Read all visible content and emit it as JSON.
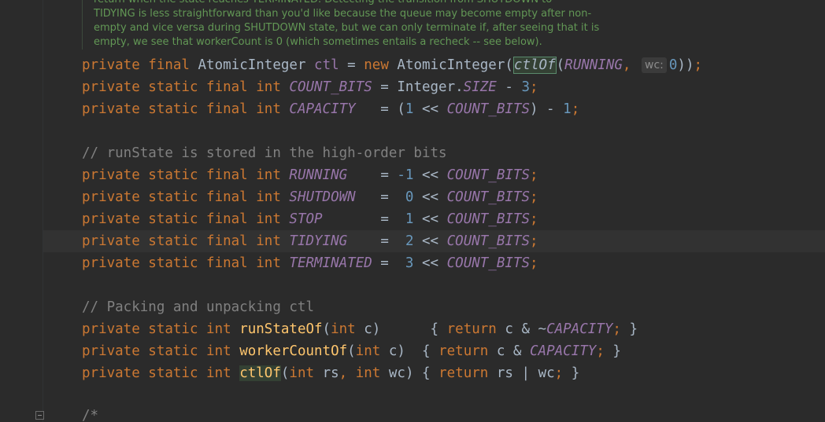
{
  "doc_comment": [
    "return when the state reaches TERMINATED. Detecting the transition from SHUTDOWN to",
    "TIDYING is less straightforward than you'd like because the queue may become empty after non-",
    "empty and vice versa during SHUTDOWN state, but we can only terminate if, after seeing that it is",
    "empty, we see that workerCount is 0 (which sometimes entails a recheck -- see below)."
  ],
  "lines": {
    "ctl": {
      "kw": "private final ",
      "type": "AtomicInteger ",
      "name": "ctl",
      "eq": " = ",
      "new": "new ",
      "ctor": "AtomicInteger(",
      "call": "ctlOf",
      "paren": "(",
      "arg1": "RUNNING",
      "comma": ", ",
      "hint": "wc:",
      "arg2": "0",
      "close": "))",
      "semi": ";"
    },
    "count_bits": {
      "kw": "private static final int ",
      "name": "COUNT_BITS",
      "eq": " = Integer.",
      "size": "SIZE",
      "minus": " - ",
      "num": "3",
      "semi": ";"
    },
    "capacity": {
      "kw": "private static final int ",
      "name": "CAPACITY",
      "eq": "   = (",
      "one": "1",
      "shift": " << ",
      "ref": "COUNT_BITS",
      "rest": ") - ",
      "num": "1",
      "semi": ";"
    },
    "comment_runstate": "// runState is stored in the high-order bits",
    "running": {
      "kw": "private static final int ",
      "name": "RUNNING",
      "eq": "    = ",
      "num": "-1",
      "shift": " << ",
      "ref": "COUNT_BITS",
      "semi": ";"
    },
    "shutdown": {
      "kw": "private static final int ",
      "name": "SHUTDOWN",
      "eq": "   =  ",
      "num": "0",
      "shift": " << ",
      "ref": "COUNT_BITS",
      "semi": ";"
    },
    "stop": {
      "kw": "private static final int ",
      "name": "STOP",
      "eq": "       =  ",
      "num": "1",
      "shift": " << ",
      "ref": "COUNT_BITS",
      "semi": ";"
    },
    "tidying": {
      "kw": "private static final int ",
      "name": "TIDYING",
      "eq": "    =  ",
      "num": "2",
      "shift": " << ",
      "ref": "COUNT_BITS",
      "semi": ";"
    },
    "terminated": {
      "kw": "private static final int ",
      "name": "TERMINATED",
      "eq": " =  ",
      "num": "3",
      "shift": " << ",
      "ref": "COUNT_BITS",
      "semi": ";"
    },
    "comment_packing": "// Packing and unpacking ctl",
    "runstateof": {
      "kw": "private static int ",
      "name": "runStateOf",
      "open": "(",
      "ptype": "int ",
      "pname": "c",
      "close": ")      { ",
      "ret": "return ",
      "expr": "c & ~",
      "ref": "CAPACITY",
      "semi": ";",
      "end": " }"
    },
    "workercountof": {
      "kw": "private static int ",
      "name": "workerCountOf",
      "open": "(",
      "ptype": "int ",
      "pname": "c",
      "close": ")  { ",
      "ret": "return ",
      "expr": "c & ",
      "ref": "CAPACITY",
      "semi": ";",
      "end": " }"
    },
    "ctlof": {
      "kw": "private static int ",
      "name": "ctlOf",
      "open": "(",
      "ptype1": "int ",
      "pname1": "rs",
      "comma": ", ",
      "ptype2": "int ",
      "pname2": "wc",
      "close": ") { ",
      "ret": "return ",
      "expr": "rs | wc",
      "semi": ";",
      "end": " }"
    },
    "comment_open": "/*"
  },
  "colors": {
    "background": "#2b2b2b",
    "keyword": "#cc7832",
    "constant": "#9876aa",
    "number": "#6897bb",
    "method": "#ffc66d",
    "comment": "#808080",
    "doc_comment": "#629755",
    "text": "#a9b7c6"
  }
}
